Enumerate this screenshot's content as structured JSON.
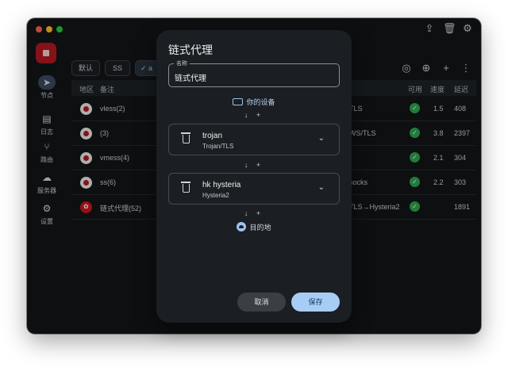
{
  "sidebar": {
    "items": [
      {
        "label": "节点",
        "icon": "send-icon"
      },
      {
        "label": "日志",
        "icon": "log-icon"
      },
      {
        "label": "路由",
        "icon": "route-icon"
      },
      {
        "label": "服务器",
        "icon": "cloud-icon"
      },
      {
        "label": "设置",
        "icon": "gear-icon"
      }
    ]
  },
  "toolbar": {
    "chips": [
      "默认",
      "SS",
      "a"
    ]
  },
  "table": {
    "headers": {
      "region": "地区",
      "remark": "备注",
      "available": "可用",
      "speed": "速度",
      "latency": "延迟"
    },
    "rows": [
      {
        "name": "vless(2)",
        "protocol": "TLS",
        "speed": "1.5",
        "latency": "408",
        "flag": "jp"
      },
      {
        "name": "(3)",
        "protocol": "WS/TLS",
        "speed": "3.8",
        "latency": "2397",
        "flag": "jp"
      },
      {
        "name": "vmess(4)",
        "protocol": "",
        "speed": "2.1",
        "latency": "304",
        "flag": "jp"
      },
      {
        "name": "ss(6)",
        "protocol": "socks",
        "speed": "2.2",
        "latency": "303",
        "flag": "jp"
      },
      {
        "name": "链式代理(52)",
        "protocol": "TLS→Hysteria2",
        "speed": "",
        "latency": "1891",
        "flag": "hk"
      }
    ]
  },
  "dialog": {
    "title": "链式代理",
    "name_label": "名称",
    "name_value": "链式代理",
    "device_label": "你的设备",
    "arrow_plus": "↓ +",
    "hops": [
      {
        "name": "trojan",
        "type": "Trojan/TLS"
      },
      {
        "name": "hk hysteria",
        "type": "Hysteria2"
      }
    ],
    "destination_label": "目的地",
    "cancel_label": "取消",
    "save_label": "保存"
  },
  "colors": {
    "accent": "#a8cdf5",
    "stop": "#b3191f",
    "ok": "#2da44e"
  }
}
